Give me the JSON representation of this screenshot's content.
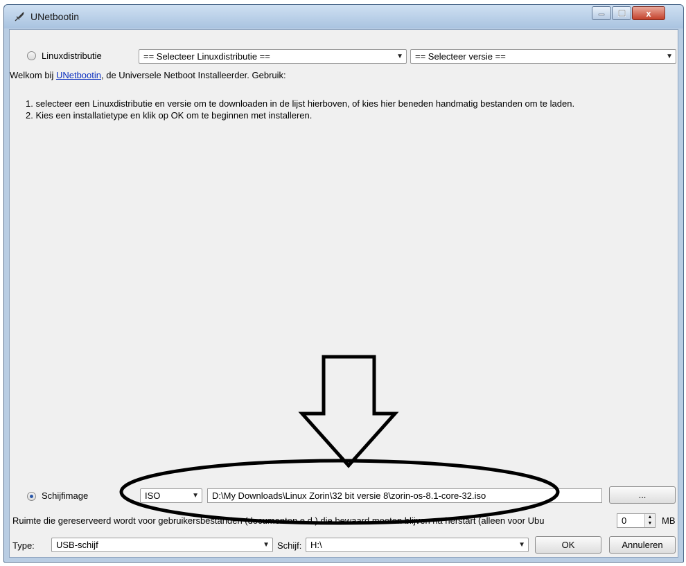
{
  "window": {
    "title": "UNetbootin",
    "close_glyph": "x"
  },
  "distribution": {
    "radio_label": "Linuxdistributie",
    "distro_select_value": "== Selecteer Linuxdistributie ==",
    "version_select_value": "== Selecteer versie =="
  },
  "intro": {
    "prefix": "Welkom bij ",
    "link_text": "UNetbootin",
    "suffix": ", de Universele Netboot Installeerder. Gebruik:",
    "steps": [
      "1. selecteer een Linuxdistributie en versie om te downloaden in de lijst hierboven, of kies hier beneden handmatig bestanden om te laden.",
      "2. Kies een installatietype en klik op OK om te beginnen met installeren."
    ]
  },
  "image": {
    "radio_label": "Schijfimage",
    "type_value": "ISO",
    "path_value": "D:\\My Downloads\\Linux Zorin\\32 bit versie 8\\zorin-os-8.1-core-32.iso",
    "browse_label": "..."
  },
  "reserve": {
    "label": "Ruimte die gereserveerd wordt voor gebruikersbestanden (documenten e.d.) die bewaard moeten blijven na herstart (alleen voor Ubu",
    "value": "0",
    "unit": "MB"
  },
  "bottom": {
    "type_label": "Type:",
    "type_value": "USB-schijf",
    "drive_label": "Schijf:",
    "drive_value": "H:\\",
    "ok_label": "OK",
    "cancel_label": "Annuleren"
  },
  "colors": {
    "titlebar": "#b9cde3",
    "client": "#f0f0f0",
    "link": "#0b2fbf",
    "close": "#c4412b",
    "annotation": "#000000"
  }
}
